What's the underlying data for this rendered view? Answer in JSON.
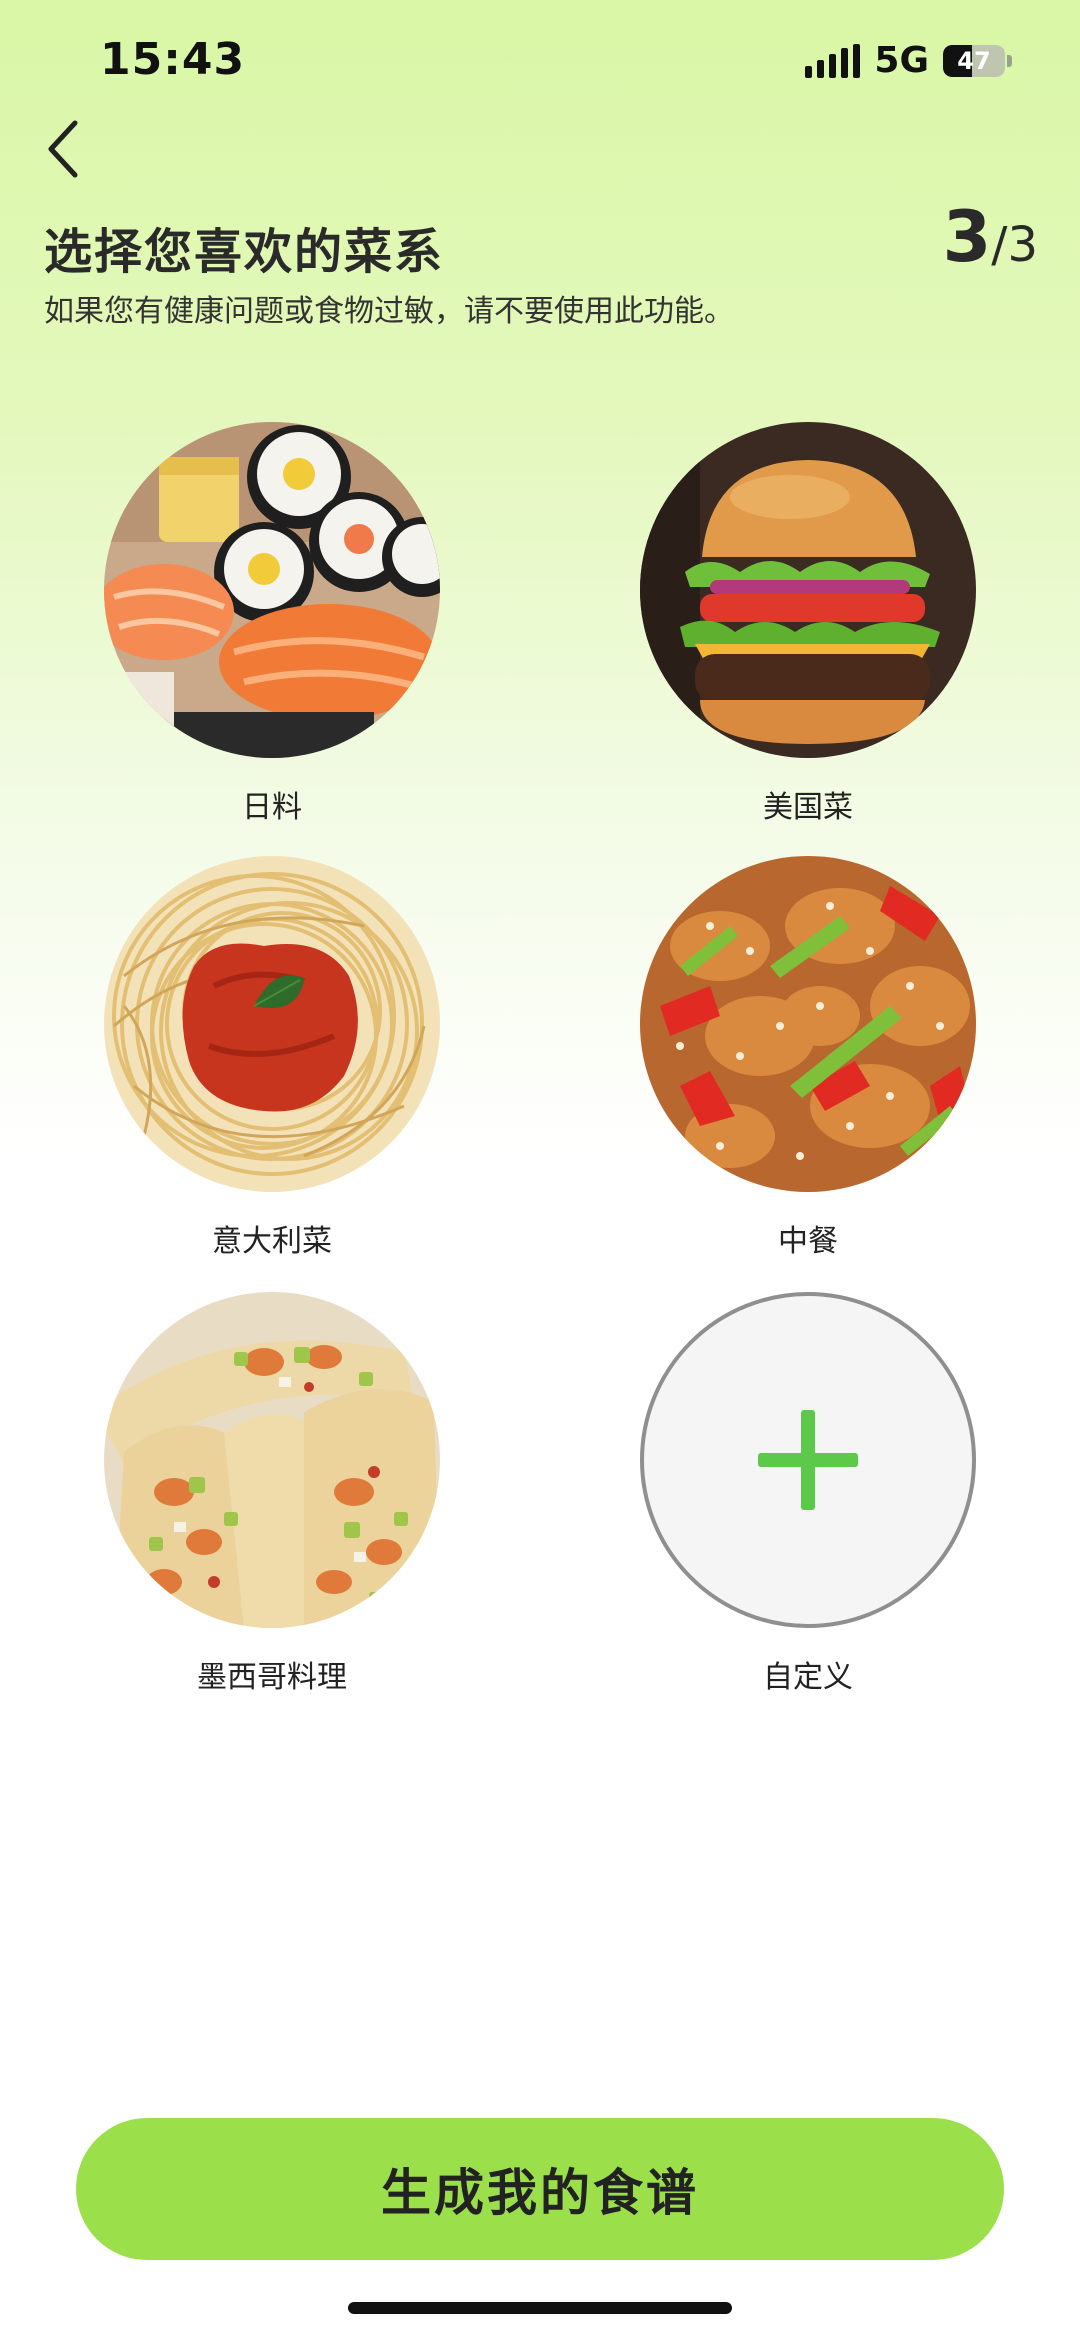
{
  "status_bar": {
    "time": "15:43",
    "network": "5G",
    "battery_level": "47",
    "battery_fraction": 0.47
  },
  "header": {
    "back_icon": "chevron-left-icon",
    "title": "选择您喜欢的菜系",
    "subtitle": "如果您有健康问题或食物过敏，请不要使用此功能。",
    "step_current": "3",
    "step_separator": "/",
    "step_total": "3"
  },
  "cuisines": [
    {
      "label": "日料",
      "image": "sushi-image"
    },
    {
      "label": "美国菜",
      "image": "burger-image"
    },
    {
      "label": "意大利菜",
      "image": "spaghetti-image"
    },
    {
      "label": "中餐",
      "image": "sweet-sour-chicken-image"
    },
    {
      "label": "墨西哥料理",
      "image": "tacos-image"
    },
    {
      "label": "自定义",
      "image": "plus-icon"
    }
  ],
  "colors": {
    "accent_green": "#9be04a",
    "plus_green": "#5cc94a"
  },
  "footer": {
    "generate_label": "生成我的食谱"
  }
}
